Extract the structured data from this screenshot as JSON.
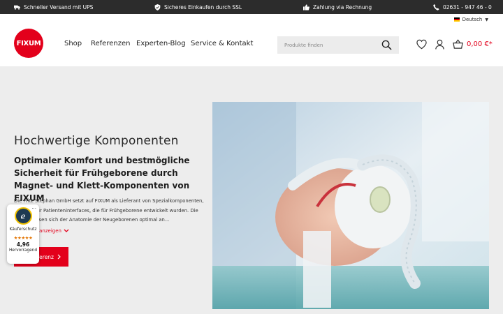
{
  "topbar": {
    "shipping": "Schneller Versand mit UPS",
    "secure": "Sicheres Einkaufen durch SSL",
    "invoice": "Zahlung via Rechnung",
    "phone": "02631 - 947 46 - 0"
  },
  "header": {
    "language": "Deutsch",
    "logo_text": "FIXUM",
    "nav": [
      "Shop",
      "Referenzen",
      "Experten-Blog",
      "Service & Kontakt"
    ],
    "search_placeholder": "Produkte finden",
    "cart_total": "0,00 €*"
  },
  "hero": {
    "title": "Hochwertige Komponenten",
    "subtitle": "Optimaler Komfort und bestmögliche Sicherheit für Frühgeborene durch Magnet- und Klett-Komponenten von FIXUM",
    "body": "Die Fritz Stephan GmbH setzt auf FIXUM als Lieferant von Spezialkomponenten, u.a. hier für Patienteninterfaces, die für Frühgeborene entwickelt wurden. Die Haken passen sich der Anatomie der Neugeborenen optimal an...",
    "more_link": "anzeigen",
    "button": "Referenz"
  },
  "trust_badge": {
    "label": "Käuferschutz",
    "stars": "★★★★★",
    "score": "4,96",
    "rating": "Hervorragend",
    "menu": "..."
  },
  "colors": {
    "accent": "#e3001b",
    "topbar": "#2c2c2c",
    "background": "#ededed"
  }
}
